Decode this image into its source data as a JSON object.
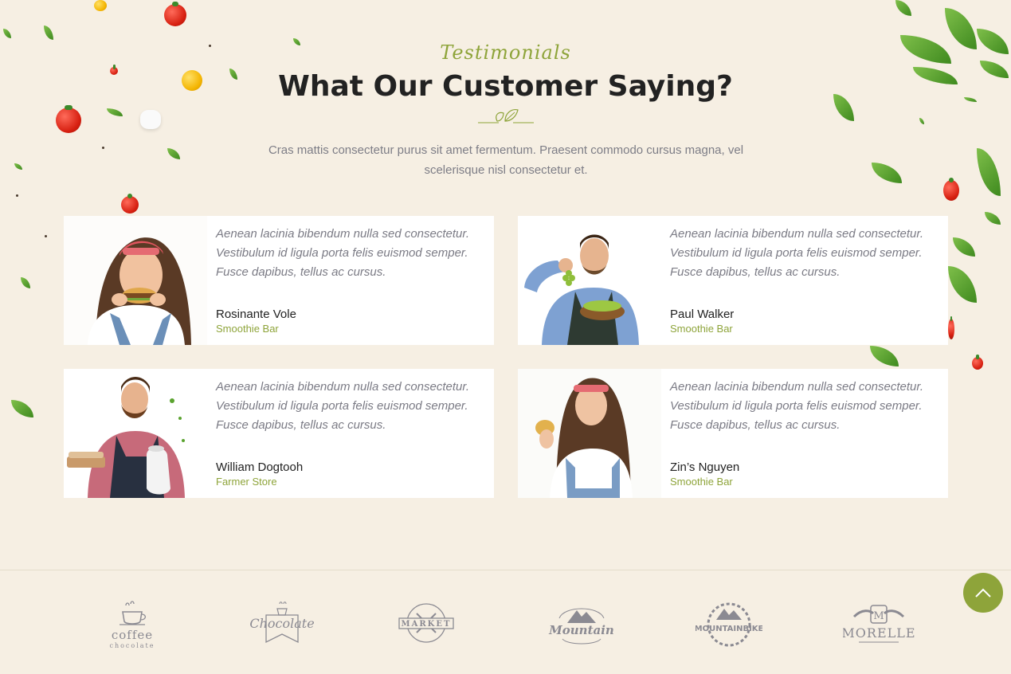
{
  "header": {
    "eyebrow": "Testimonials",
    "title": "What Our Customer Saying?",
    "intro": "Cras mattis consectetur purus sit amet fermentum. Praesent commodo cursus magna, vel scelerisque nisl consectetur et."
  },
  "testimonials": [
    {
      "quote": "Aenean lacinia bibendum nulla sed consectetur. Vestibulum id ligula porta felis euismod semper. Fusce dapibus, tellus ac cursus.",
      "name": "Rosinante Vole",
      "role": "Smoothie Bar"
    },
    {
      "quote": "Aenean lacinia bibendum nulla sed consectetur. Vestibulum id ligula porta felis euismod semper. Fusce dapibus, tellus ac cursus.",
      "name": "Paul Walker",
      "role": "Smoothie Bar"
    },
    {
      "quote": "Aenean lacinia bibendum nulla sed consectetur. Vestibulum id ligula porta felis euismod semper. Fusce dapibus, tellus ac cursus.",
      "name": "William Dogtooh",
      "role": "Farmer Store"
    },
    {
      "quote": "Aenean lacinia bibendum nulla sed consectetur. Vestibulum id ligula porta felis euismod semper. Fusce dapibus, tellus ac cursus.",
      "name": "Zin’s Nguyen",
      "role": "Smoothie Bar"
    }
  ],
  "brands": [
    {
      "name": "coffee",
      "sub": "chocolate",
      "icon": "coffee-cup-icon"
    },
    {
      "name": "Chocolate",
      "icon": "chocolate-ribbon-icon"
    },
    {
      "name": "MARKET",
      "icon": "market-emblem-icon"
    },
    {
      "name": "Mountain",
      "icon": "mountain-icon"
    },
    {
      "name": "MOUNTAINBIKE",
      "icon": "mountainbike-gear-icon"
    },
    {
      "name": "MORELLE",
      "icon": "morelle-crest-icon"
    }
  ],
  "colors": {
    "accent": "#8ea43a",
    "background": "#f6efe3",
    "heading": "#222222",
    "text": "#7b7b85"
  },
  "scroll_top": {
    "icon": "chevron-up-icon"
  }
}
